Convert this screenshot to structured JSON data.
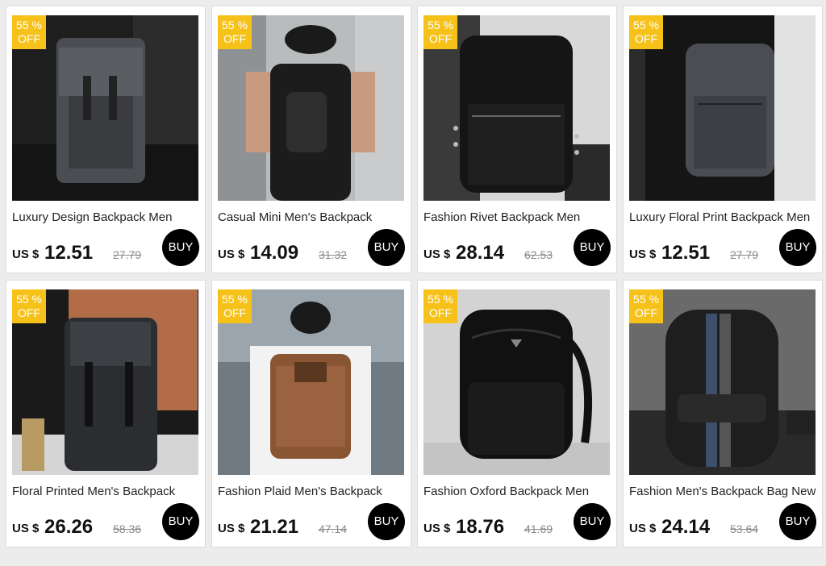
{
  "badge": {
    "line1": "55 %",
    "line2": "OFF"
  },
  "currency": "US $",
  "buy_label": "BUY",
  "colors": {
    "badge": "#f6c21a",
    "buy_button": "#000000",
    "page_bg": "#ececec"
  },
  "products": [
    {
      "title": "Luxury Design Backpack Men",
      "price": "12.51",
      "old_price": "27.79"
    },
    {
      "title": "Casual Mini Men's Backpack",
      "price": "14.09",
      "old_price": "31.32"
    },
    {
      "title": "Fashion Rivet Backpack Men",
      "price": "28.14",
      "old_price": "62.53"
    },
    {
      "title": "Luxury Floral Print Backpack Men",
      "price": "12.51",
      "old_price": "27.79"
    },
    {
      "title": "Floral Printed Men's Backpack",
      "price": "26.26",
      "old_price": "58.36"
    },
    {
      "title": "Fashion Plaid Men's Backpack",
      "price": "21.21",
      "old_price": "47.14"
    },
    {
      "title": "Fashion Oxford Backpack Men",
      "price": "18.76",
      "old_price": "41.69"
    },
    {
      "title": "Fashion Men's Backpack Bag New",
      "price": "24.14",
      "old_price": "53.64"
    }
  ]
}
